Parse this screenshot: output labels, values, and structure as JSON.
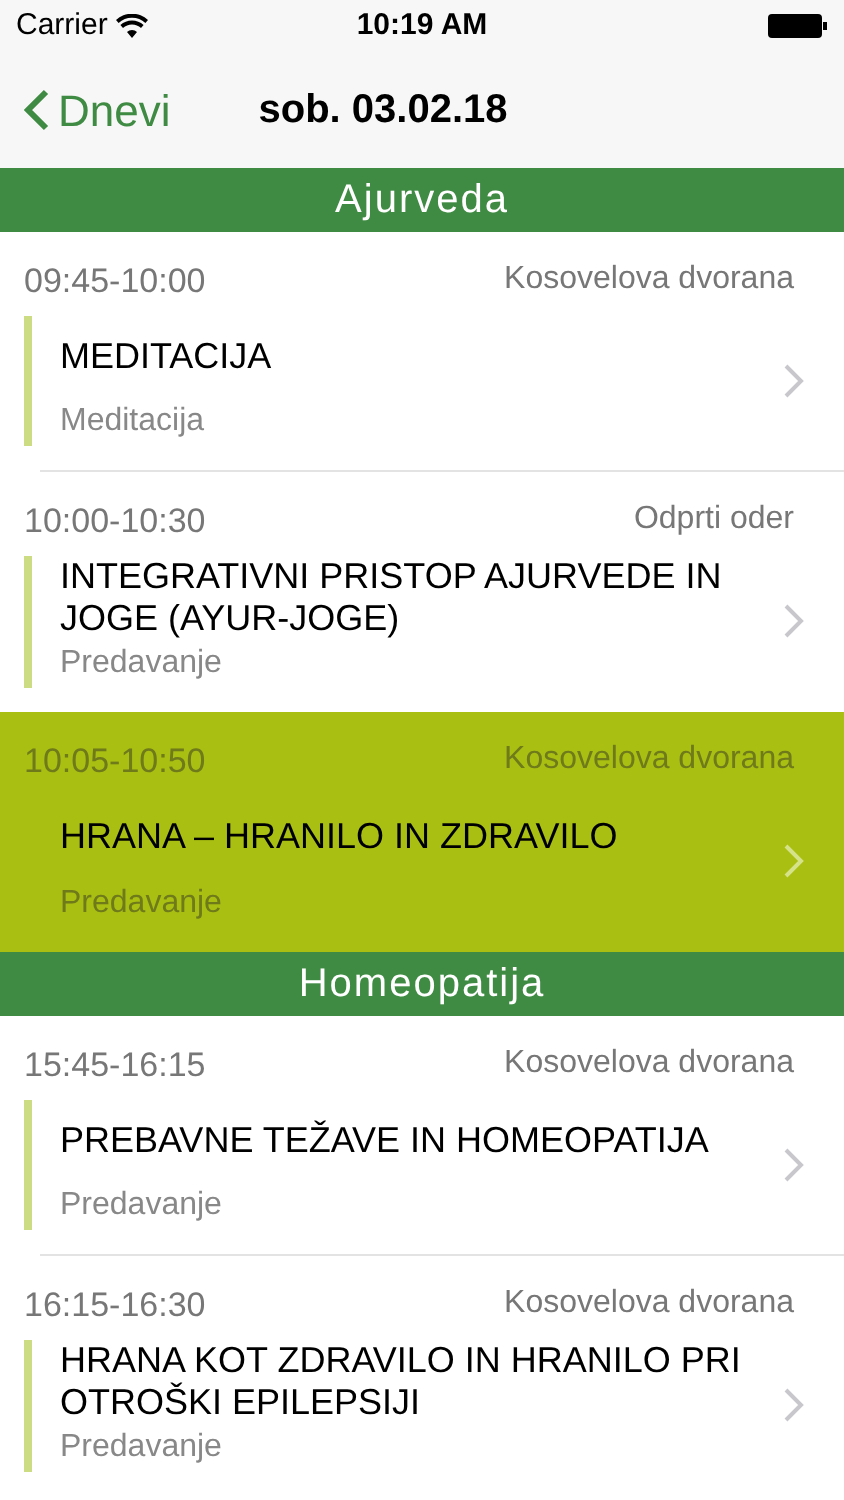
{
  "status_bar": {
    "carrier": "Carrier",
    "time": "10:19 AM"
  },
  "nav": {
    "back": "Dnevi",
    "title": "sob. 03.02.18"
  },
  "sections": [
    {
      "title": "Ajurveda",
      "items": [
        {
          "time": "09:45-10:00",
          "place": "Kosovelova dvorana",
          "title": "MEDITACIJA",
          "type": "Meditacija",
          "selected": false
        },
        {
          "time": "10:00-10:30",
          "place": "Odprti oder",
          "title": "INTEGRATIVNI PRISTOP AJURVEDE IN JOGE (AYUR-JOGE)",
          "type": "Predavanje",
          "selected": false
        },
        {
          "time": "10:05-10:50",
          "place": "Kosovelova dvorana",
          "title": "HRANA – HRANILO IN ZDRAVILO",
          "type": "Predavanje",
          "selected": true
        }
      ]
    },
    {
      "title": "Homeopatija",
      "items": [
        {
          "time": "15:45-16:15",
          "place": "Kosovelova dvorana",
          "title": "PREBAVNE TEŽAVE IN HOMEOPATIJA",
          "type": "Predavanje",
          "selected": false
        },
        {
          "time": "16:15-16:30",
          "place": "Kosovelova dvorana",
          "title": "HRANA KOT ZDRAVILO IN HRANILO PRI OTROŠKI EPILEPSIJI",
          "type": "Predavanje",
          "selected": false
        }
      ]
    }
  ]
}
